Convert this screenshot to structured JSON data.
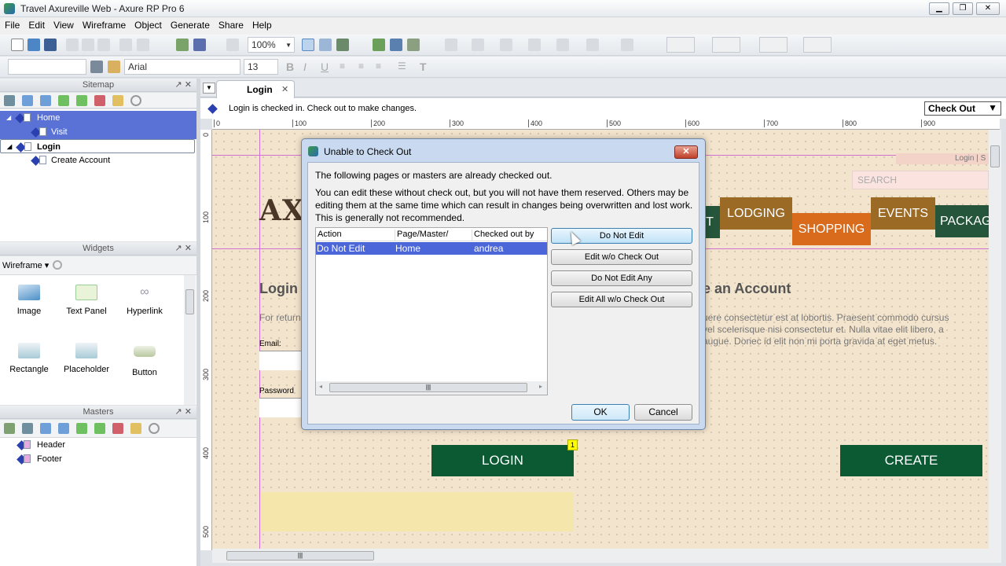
{
  "window": {
    "title": "Travel Axureville Web - Axure RP Pro 6",
    "controls": [
      "minimize",
      "restore",
      "close"
    ]
  },
  "menu": [
    "File",
    "Edit",
    "View",
    "Wireframe",
    "Object",
    "Generate",
    "Share",
    "Help"
  ],
  "toolbar": {
    "zoom": "100%",
    "font_family": "Arial",
    "font_size": "13",
    "style_value": ""
  },
  "sitemap": {
    "title": "Sitemap",
    "items": [
      {
        "label": "Home",
        "level": 0,
        "selected": true
      },
      {
        "label": "Visit",
        "level": 1,
        "selected": true
      },
      {
        "label": "Login",
        "level": 0,
        "selected": false,
        "current": true
      },
      {
        "label": "Create Account",
        "level": 1,
        "selected": false
      }
    ]
  },
  "widgets": {
    "title": "Widgets",
    "library": "Wireframe",
    "items": [
      "Image",
      "Text Panel",
      "Hyperlink",
      "Rectangle",
      "Placeholder",
      "Button"
    ]
  },
  "masters": {
    "title": "Masters",
    "items": [
      "Header",
      "Footer"
    ]
  },
  "editor": {
    "tab": "Login",
    "info": "Login is checked in. Check out to make changes.",
    "checkout_label": "Check Out",
    "ruler_top": [
      "0",
      "100",
      "200",
      "300",
      "400",
      "500",
      "600",
      "700",
      "800",
      "900"
    ],
    "ruler_left": [
      "0",
      "100",
      "200",
      "300",
      "400",
      "500"
    ]
  },
  "canvas": {
    "logo": "AXU",
    "login_link": "Login | S",
    "search_placeholder": "SEARCH",
    "nav": [
      "T",
      "LODGING",
      "SHOPPING",
      "EVENTS",
      "PACKAG"
    ],
    "login_heading": "Login",
    "create_heading": "e an Account",
    "returning_text": "For return",
    "lorem": [
      "uere consectetur est at lobortis. Praesent commodo cursus",
      "vel scelerisque nisi consectetur et. Nulla vitae elit libero, a",
      "augue. Donec id elit non mi porta gravida at eget metus."
    ],
    "email_label": "Email:",
    "password_label": "Password",
    "login_button": "LOGIN",
    "create_button": "CREATE",
    "note_badge": "1",
    "colors": {
      "nav_dark": "#25553a",
      "nav_brown": "#9b6a25",
      "nav_orange": "#d96b1c",
      "button": "#0b5a33"
    }
  },
  "dialog": {
    "title": "Unable to Check Out",
    "line1": "The following pages or masters are already checked out.",
    "line2": "You can edit these without check out, but you will not have them reserved. Others may be editing them at the same time which can result in changes being overwritten and lost work. This is generally not recommended.",
    "columns": [
      "Action",
      "Page/Master/",
      "Checked out by"
    ],
    "rows": [
      [
        "Do Not Edit",
        "Home",
        "andrea"
      ]
    ],
    "actions": [
      "Do Not Edit",
      "Edit w/o Check Out",
      "Do Not Edit Any",
      "Edit All w/o Check Out"
    ],
    "ok": "OK",
    "cancel": "Cancel"
  }
}
